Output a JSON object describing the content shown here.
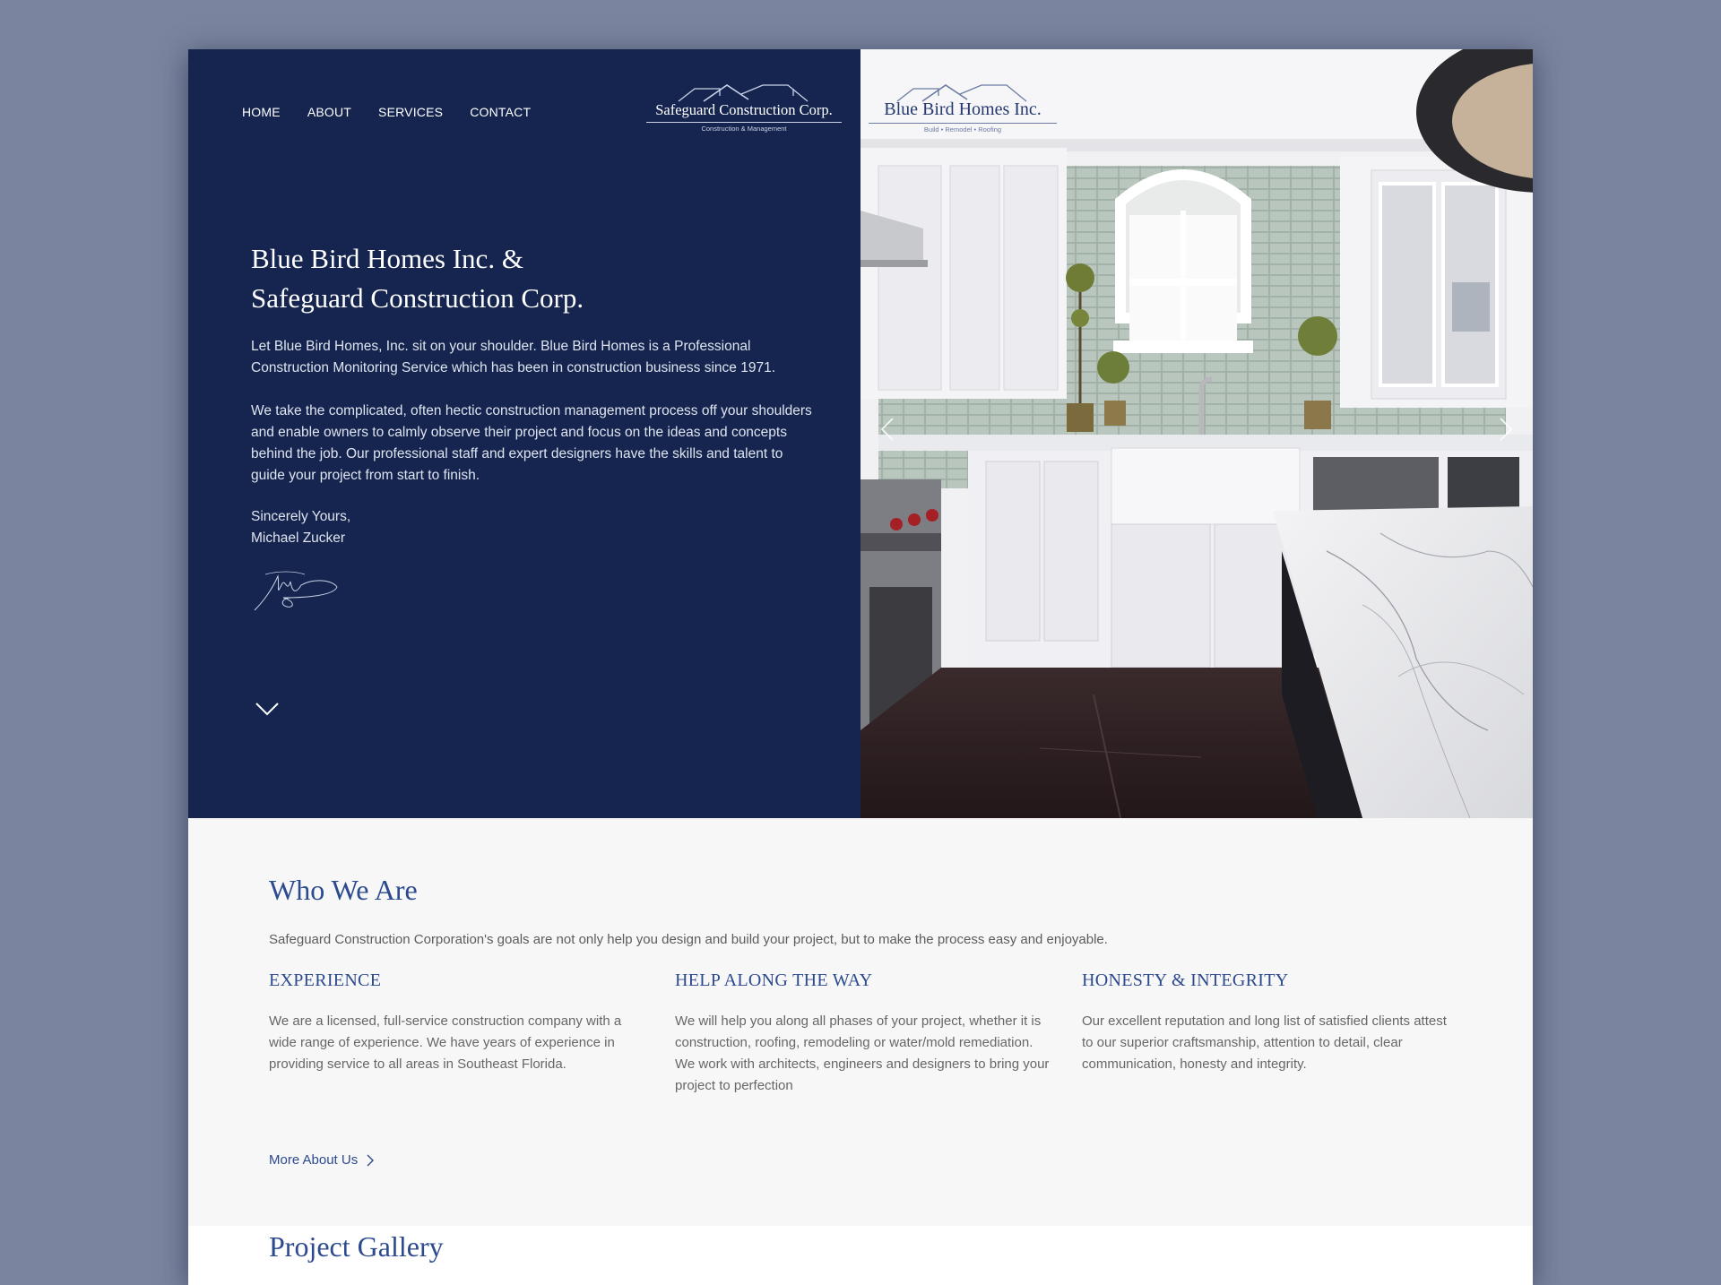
{
  "nav": {
    "items": [
      "HOME",
      "ABOUT",
      "SERVICES",
      "CONTACT"
    ]
  },
  "logos": {
    "safeguard": {
      "name": "Safeguard Construction Corp.",
      "tagline": "Construction & Management"
    },
    "bluebird": {
      "name": "Blue Bird Homes Inc.",
      "tagline": "Build • Remodel • Roofing"
    }
  },
  "hero": {
    "title_line1": "Blue Bird Homes Inc. &",
    "title_line2": "Safeguard Construction Corp.",
    "p1": "Let Blue Bird Homes, Inc. sit on your shoulder. Blue Bird Homes is a Professional Construction Monitoring Service which has been in construction business since 1971.",
    "p2": "We take the complicated, often hectic construction management process off your shoulders and enable owners to calmly observe their project and focus on the ideas and concepts behind the job. Our professional staff and expert designers have the skills and talent to guide your project from start to finish.",
    "closing": "Sincerely Yours,",
    "signer": "Michael Zucker"
  },
  "who": {
    "title": "Who We Are",
    "lead": "Safeguard Construction Corporation's goals are not only help you design and build your project, but to make the process easy and enjoyable.",
    "columns": [
      {
        "title": "EXPERIENCE",
        "text": "We are a licensed, full-service construction company with a wide range of experience. We have years of experience in providing service to all areas in Southeast Florida."
      },
      {
        "title": "HELP ALONG THE WAY",
        "text": "We will help you along all phases of your project, whether it is construction, roofing, remodeling or water/mold remediation. We work with architects, engineers and designers to bring your project to perfection"
      },
      {
        "title": "HONESTY & INTEGRITY",
        "text": "Our excellent reputation and long list of satisfied clients attest to our superior craftsmanship, attention to detail, clear communication, honesty and integrity."
      }
    ],
    "more_link": "More About Us"
  },
  "gallery": {
    "title": "Project Gallery"
  },
  "colors": {
    "navy": "#15254f",
    "accent_blue": "#2c4a8e",
    "page_bg": "#7a849e",
    "section_bg": "#f7f7f7"
  },
  "icons": [
    "chevron-down-icon",
    "chevron-left-icon",
    "chevron-right-icon",
    "chevron-right-small-icon",
    "roof-icon"
  ]
}
